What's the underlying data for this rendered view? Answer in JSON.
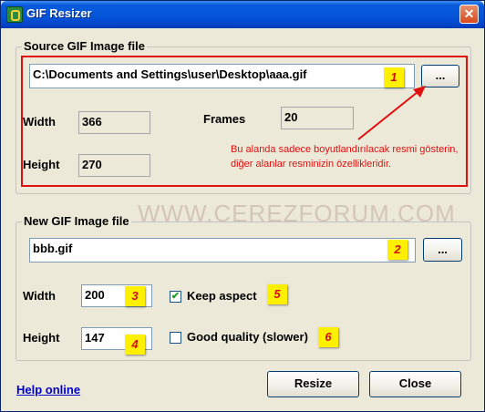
{
  "window": {
    "title": "GIF Resizer",
    "close_label": "✕"
  },
  "watermark": "WWW.CEREZFORUM.COM",
  "source": {
    "group_title": "Source GIF Image file",
    "path": "C:\\Documents and Settings\\user\\Desktop\\aaa.gif",
    "browse_label": "...",
    "width_label": "Width",
    "width_value": "366",
    "height_label": "Height",
    "height_value": "270",
    "frames_label": "Frames",
    "frames_value": "20",
    "note": "Bu alanda sadece boyutlandırılacak resmi gösterin, diğer alanlar resminizin özellikleridir."
  },
  "target": {
    "group_title": "New GIF Image file",
    "filename": "bbb.gif",
    "browse_label": "...",
    "width_label": "Width",
    "width_value": "200",
    "height_label": "Height",
    "height_value": "147",
    "keep_aspect_label": "Keep aspect",
    "keep_aspect_checked": true,
    "good_quality_label": "Good quality (slower)",
    "good_quality_checked": false
  },
  "badges": [
    "1",
    "2",
    "3",
    "4",
    "5",
    "6"
  ],
  "footer": {
    "help_label": "Help online",
    "resize_label": "Resize",
    "close_label": "Close"
  },
  "colors": {
    "titlebar": "#0554d8",
    "annotation_red": "#e01010",
    "badge_yellow": "#ffef00",
    "link_blue": "#0000cc"
  }
}
